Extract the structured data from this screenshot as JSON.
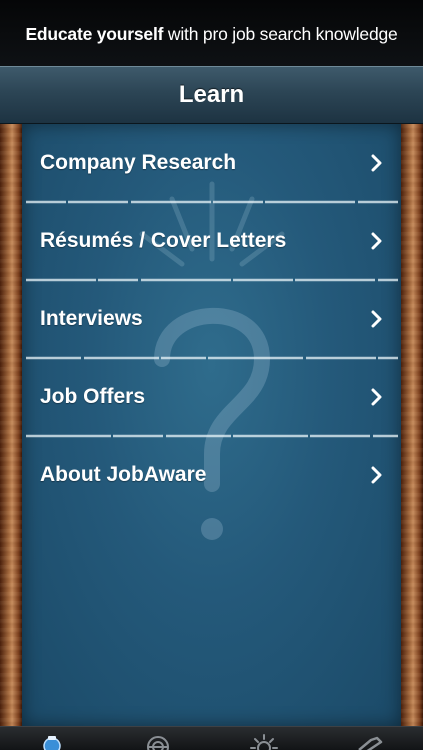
{
  "banner": {
    "strong_text": "Educate yourself",
    "light_text": " with pro job search knowledge"
  },
  "navbar": {
    "title": "Learn"
  },
  "menu": {
    "items": [
      {
        "label": "Company Research"
      },
      {
        "label": "Résumés / Cover Letters"
      },
      {
        "label": "Interviews"
      },
      {
        "label": "Job Offers"
      },
      {
        "label": "About JobAware"
      }
    ]
  },
  "tabbar": {
    "tabs": [
      {
        "icon": "lightbulb-icon",
        "selected": true
      },
      {
        "icon": "target-icon",
        "selected": false
      },
      {
        "icon": "sun-icon",
        "selected": false
      },
      {
        "icon": "tools-icon",
        "selected": false
      }
    ]
  },
  "colors": {
    "chalkboard": "#24597a",
    "navbar": "#2c4555",
    "wood": "#9a5a30",
    "text": "#ffffff"
  }
}
